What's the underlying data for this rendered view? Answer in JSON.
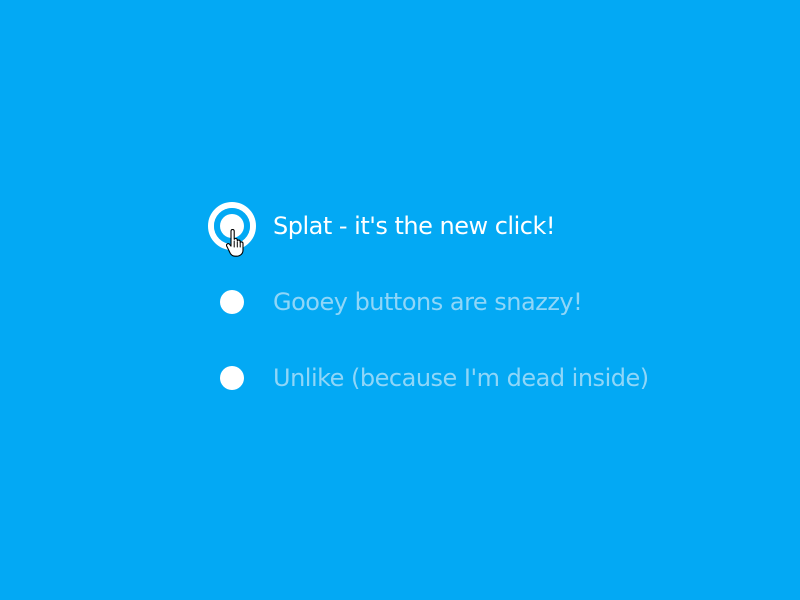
{
  "colors": {
    "background": "#03a9f4",
    "selected_text": "#ffffff",
    "unselected_text": "#8fd6f8",
    "radio": "#ffffff"
  },
  "options": [
    {
      "label": "Splat - it's the new click!",
      "selected": true
    },
    {
      "label": "Gooey buttons are snazzy!",
      "selected": false
    },
    {
      "label": "Unlike (because I'm dead inside)",
      "selected": false
    }
  ],
  "cursor": {
    "icon": "hand-pointer-icon"
  }
}
